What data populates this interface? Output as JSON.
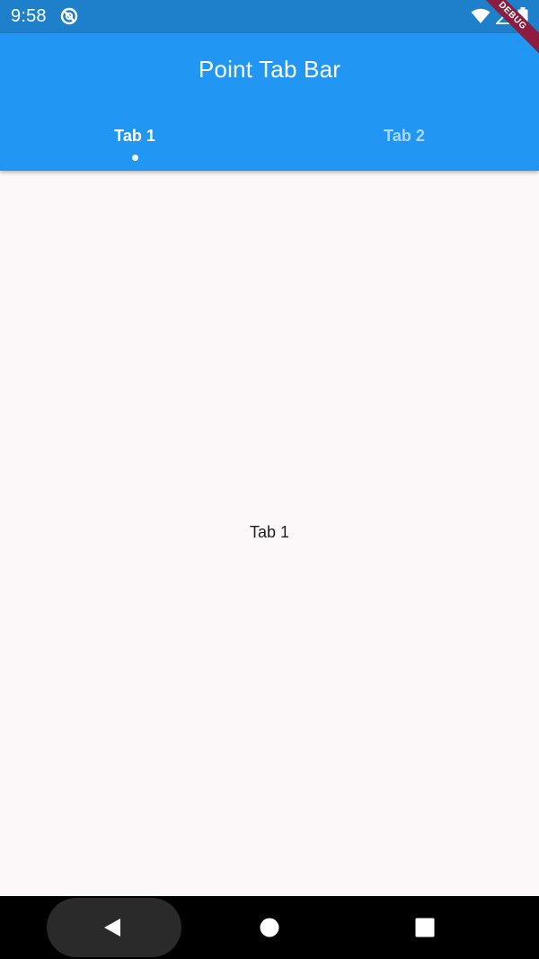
{
  "status_bar": {
    "time": "9:58",
    "icons": [
      "sync-disabled-icon",
      "wifi-icon",
      "signal-icon",
      "battery-icon"
    ]
  },
  "debug_banner": "DEBUG",
  "app_bar": {
    "title": "Point Tab Bar",
    "color": "#2196f3"
  },
  "tabs": [
    {
      "label": "Tab 1",
      "selected": true
    },
    {
      "label": "Tab 2",
      "selected": false
    }
  ],
  "content": {
    "text": "Tab 1"
  },
  "nav_bar": {
    "buttons": [
      "back-icon",
      "home-icon",
      "recents-icon"
    ]
  }
}
